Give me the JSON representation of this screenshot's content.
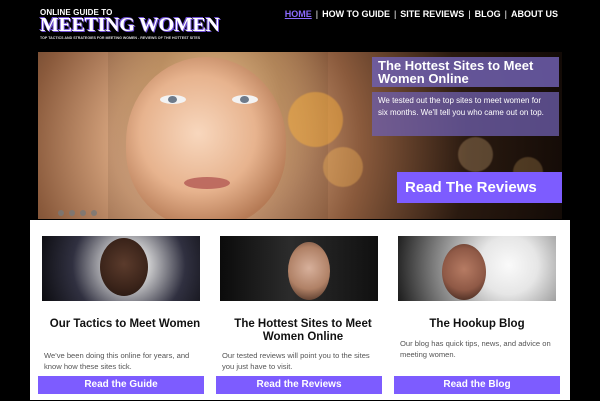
{
  "branding": {
    "logo_top": "ONLINE GUIDE TO",
    "logo_main": "MEETING WOMEN",
    "logo_tagline": "TOP TACTICS AND STRATEGIES FOR MEETING WOMEN - REVIEWS OF THE HOTTEST SITES"
  },
  "nav": {
    "items": [
      {
        "label": "HOME",
        "active": true
      },
      {
        "label": "HOW TO GUIDE"
      },
      {
        "label": "SITE REVIEWS"
      },
      {
        "label": "BLOG"
      },
      {
        "label": "ABOUT US"
      }
    ],
    "separator": "|"
  },
  "hero": {
    "title": "The Hottest Sites to Meet Women Online",
    "subtitle": "We tested out the top sites to meet women for six months. We'll tell you who came out on top.",
    "cta_label": "Read The Reviews",
    "dots_count": 4
  },
  "columns": [
    {
      "heading": "Our Tactics to Meet Women",
      "description": "We've been doing this online for years, and know how these sites tick.",
      "button_label": "Read the Guide"
    },
    {
      "heading": "The Hottest Sites to Meet Women Online",
      "description": "Our tested reviews will point you to the sites you just have to visit.",
      "button_label": "Read the Reviews"
    },
    {
      "heading": "The Hookup Blog",
      "description": "Our blog has quick tips, news, and advice on meeting women.",
      "button_label": "Read the Blog"
    }
  ],
  "colors": {
    "accent": "#7d5cff",
    "nav_active": "#8b6bff",
    "hero_panel": "#6e5faf"
  }
}
